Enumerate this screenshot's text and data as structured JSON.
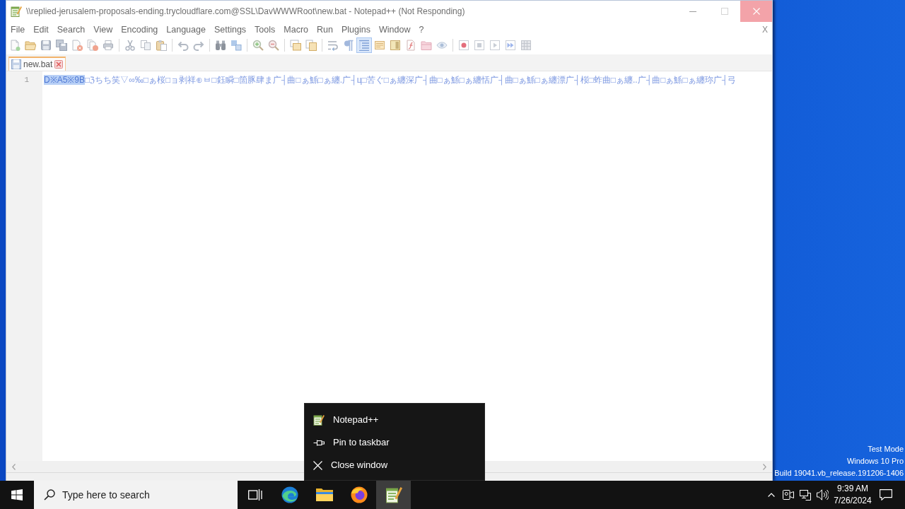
{
  "window": {
    "title": "\\\\replied-jerusalem-proposals-ending.trycloudflare.com@SSL\\DavWWWRoot\\new.bat - Notepad++ (Not Responding)",
    "menu": [
      "File",
      "Edit",
      "Search",
      "View",
      "Encoding",
      "Language",
      "Settings",
      "Tools",
      "Macro",
      "Run",
      "Plugins",
      "Window",
      "?"
    ],
    "close_document": "X"
  },
  "toolbar": {
    "buttons": [
      {
        "on": false
      },
      {
        "on": false
      },
      {
        "on": false
      },
      {
        "on": false
      },
      {
        "on": false
      },
      {
        "on": false
      },
      {
        "on": false
      },
      {
        "on": false
      },
      {
        "on": false
      },
      {
        "on": false
      },
      {
        "on": false
      },
      {
        "on": false
      },
      {
        "on": false
      },
      {
        "on": false
      },
      {
        "on": false
      },
      {
        "on": false
      },
      {
        "on": false
      },
      {
        "on": false
      },
      {
        "on": false
      },
      {
        "on": false
      },
      {
        "on": true
      },
      {
        "on": false
      },
      {
        "on": false
      },
      {
        "on": false
      },
      {
        "on": false
      },
      {
        "on": false
      },
      {
        "on": false
      },
      {
        "on": false
      },
      {
        "on": false
      },
      {
        "on": false
      },
      {
        "on": false
      }
    ]
  },
  "tabs": [
    {
      "label": "new.bat",
      "selected": true
    }
  ],
  "editor": {
    "lines": [
      {
        "number": "1",
        "segments": [
          {
            "text": "D※A5※9B",
            "highlighted": true
          },
          {
            "text": "□ℨちち笑▽∞‰□ぁ桜□ョ剥祥⊕ㅂ□鈺瞬□箇豚肆ま广┤曲□ぁ鯀□ぁ纏.广┤ц□苦ぐ□ぁ纏深广┤曲□ぁ鯀□ぁ纏恬广┤曲□ぁ鯀□ぁ纏漂广┤桜□蚱曲□ぁ纏..广┤曲□ぁ鯀□ぁ纏珎广┤弓",
            "highlighted": false
          }
        ]
      }
    ]
  },
  "jump_list": {
    "items": [
      {
        "kind": "app",
        "label": "Notepad++"
      },
      {
        "kind": "pin",
        "label": "Pin to taskbar"
      },
      {
        "kind": "close",
        "label": "Close window"
      }
    ]
  },
  "taskbar": {
    "search": {
      "placeholder": "Type here to search"
    },
    "apps": [
      {
        "kind": "task_view",
        "selected": false
      },
      {
        "kind": "edge",
        "selected": false
      },
      {
        "kind": "explorer",
        "selected": false
      },
      {
        "kind": "firefox",
        "selected": false
      },
      {
        "kind": "notepad",
        "selected": true
      }
    ],
    "clock": {
      "time": "9:39 AM",
      "date": "7/26/2024"
    }
  },
  "desktop": {
    "system_notice": [
      "Test Mode",
      "Windows 10 Pro",
      "Build 19041.vb_release.191206-1406"
    ]
  }
}
